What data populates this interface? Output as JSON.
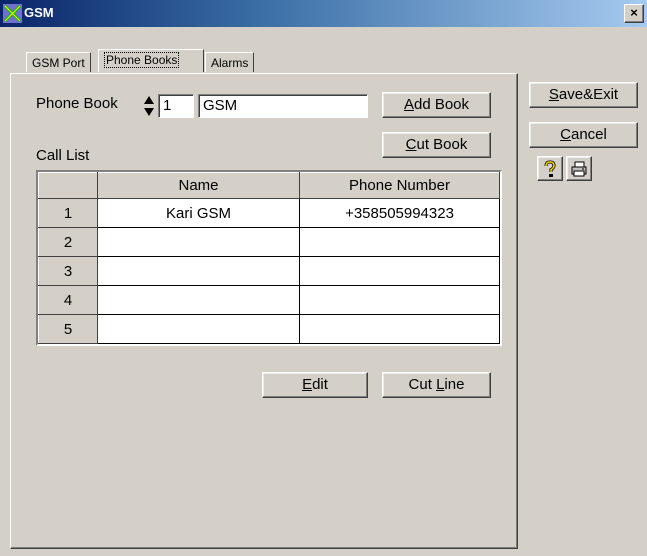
{
  "window": {
    "title": "GSM",
    "close_label": "×"
  },
  "tabs": [
    {
      "label": "GSM Port"
    },
    {
      "label": "Phone Books"
    },
    {
      "label": "Alarms"
    }
  ],
  "phonebook": {
    "label": "Phone Book",
    "number": "1",
    "name": "GSM",
    "add_book_pre": "",
    "add_book_ul": "A",
    "add_book_post": "dd Book",
    "cut_book_pre": "",
    "cut_book_ul": "C",
    "cut_book_post": "ut Book"
  },
  "call_list": {
    "label": "Call List",
    "columns": [
      "",
      "Name",
      "Phone Number"
    ],
    "rows": [
      {
        "num": "1",
        "name": "Kari GSM",
        "phone": "+358505994323"
      },
      {
        "num": "2",
        "name": "",
        "phone": ""
      },
      {
        "num": "3",
        "name": "",
        "phone": ""
      },
      {
        "num": "4",
        "name": "",
        "phone": ""
      },
      {
        "num": "5",
        "name": "",
        "phone": ""
      }
    ]
  },
  "actions": {
    "edit_pre": "",
    "edit_ul": "E",
    "edit_post": "dit",
    "cutline_pre": "Cut ",
    "cutline_ul": "L",
    "cutline_post": "ine"
  },
  "side": {
    "save_pre": "",
    "save_ul": "S",
    "save_post": "ave&Exit",
    "cancel_pre": "",
    "cancel_ul": "C",
    "cancel_post": "ancel",
    "help_icon": "help-icon",
    "print_icon": "printer-icon"
  },
  "colors": {
    "title_start": "#0a246a",
    "title_end": "#a6caf0",
    "face": "#d4d0c8"
  }
}
